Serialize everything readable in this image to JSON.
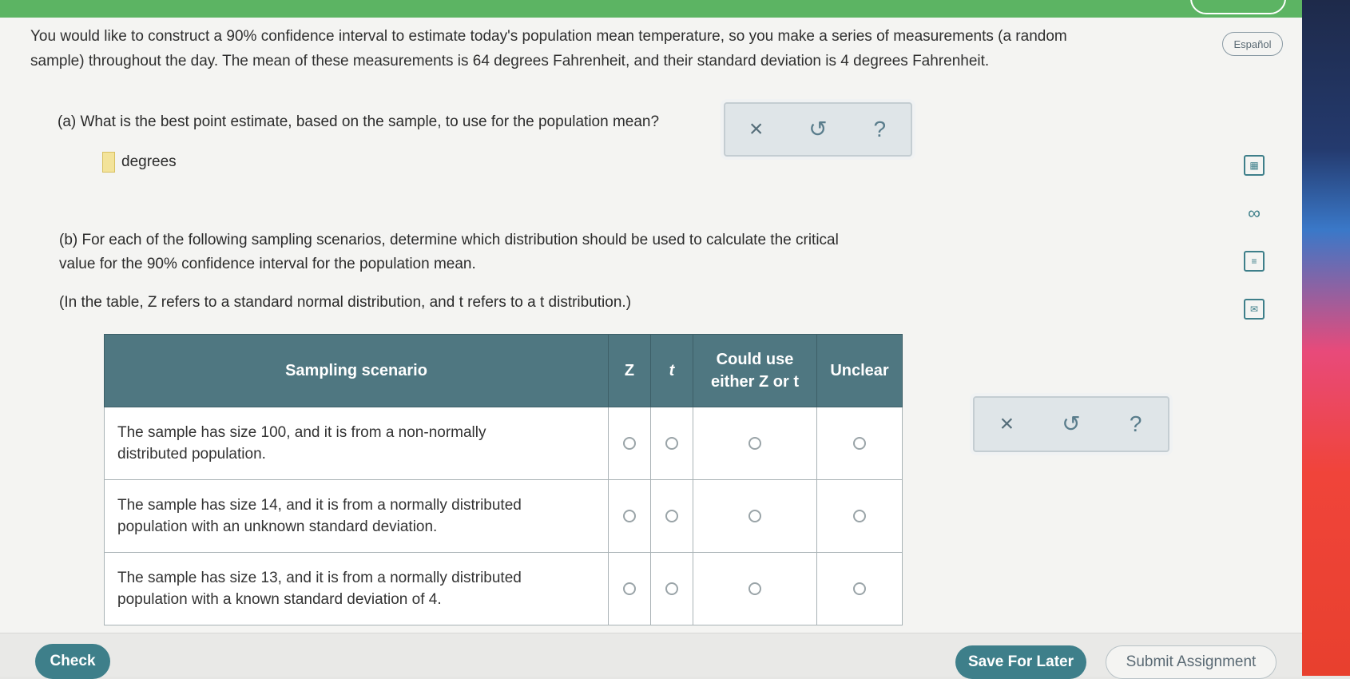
{
  "intro": {
    "line1": "You would like to construct a 90% confidence interval to estimate today's population mean temperature, so you make a series of measurements (a random",
    "line2": "sample) throughout the day. The mean of these measurements is 64 degrees Fahrenheit, and their standard deviation is 4 degrees Fahrenheit."
  },
  "espanol_label": "Español",
  "part_a": {
    "question": "(a) What is the best point estimate, based on the sample, to use for the population mean?",
    "unit": "degrees",
    "answer_value": ""
  },
  "part_b": {
    "question_line1": "(b) For each of the following sampling scenarios, determine which distribution should be used to calculate the critical",
    "question_line2": "value for the 90% confidence interval for the population mean.",
    "note": "(In the table, Z refers to a standard normal distribution, and t refers to a t distribution.)"
  },
  "tools": {
    "close": "×",
    "undo": "↺",
    "help": "?"
  },
  "side_icons": [
    "calculator-icon",
    "infinity-icon",
    "notes-icon",
    "mail-icon"
  ],
  "table": {
    "headers": [
      "Sampling scenario",
      "Z",
      "t",
      "Could use either Z or t",
      "Unclear"
    ],
    "header_either_line1": "Could use",
    "header_either_line2": "either Z or t",
    "rows": [
      {
        "line1": "The sample has size 100, and it is from a non-normally",
        "line2": "distributed population."
      },
      {
        "line1": "The sample has size 14, and it is from a normally distributed",
        "line2": "population with an unknown standard deviation."
      },
      {
        "line1": "The sample has size 13, and it is from a normally distributed",
        "line2": "population with a known standard deviation of 4."
      }
    ]
  },
  "buttons": {
    "check": "Check",
    "save": "Save For Later",
    "submit": "Submit Assignment"
  },
  "colors": {
    "accent": "#3e7f8a",
    "header_bg": "#4f7781",
    "top_band": "#5cb463",
    "answer_box": "#f3e39a"
  }
}
